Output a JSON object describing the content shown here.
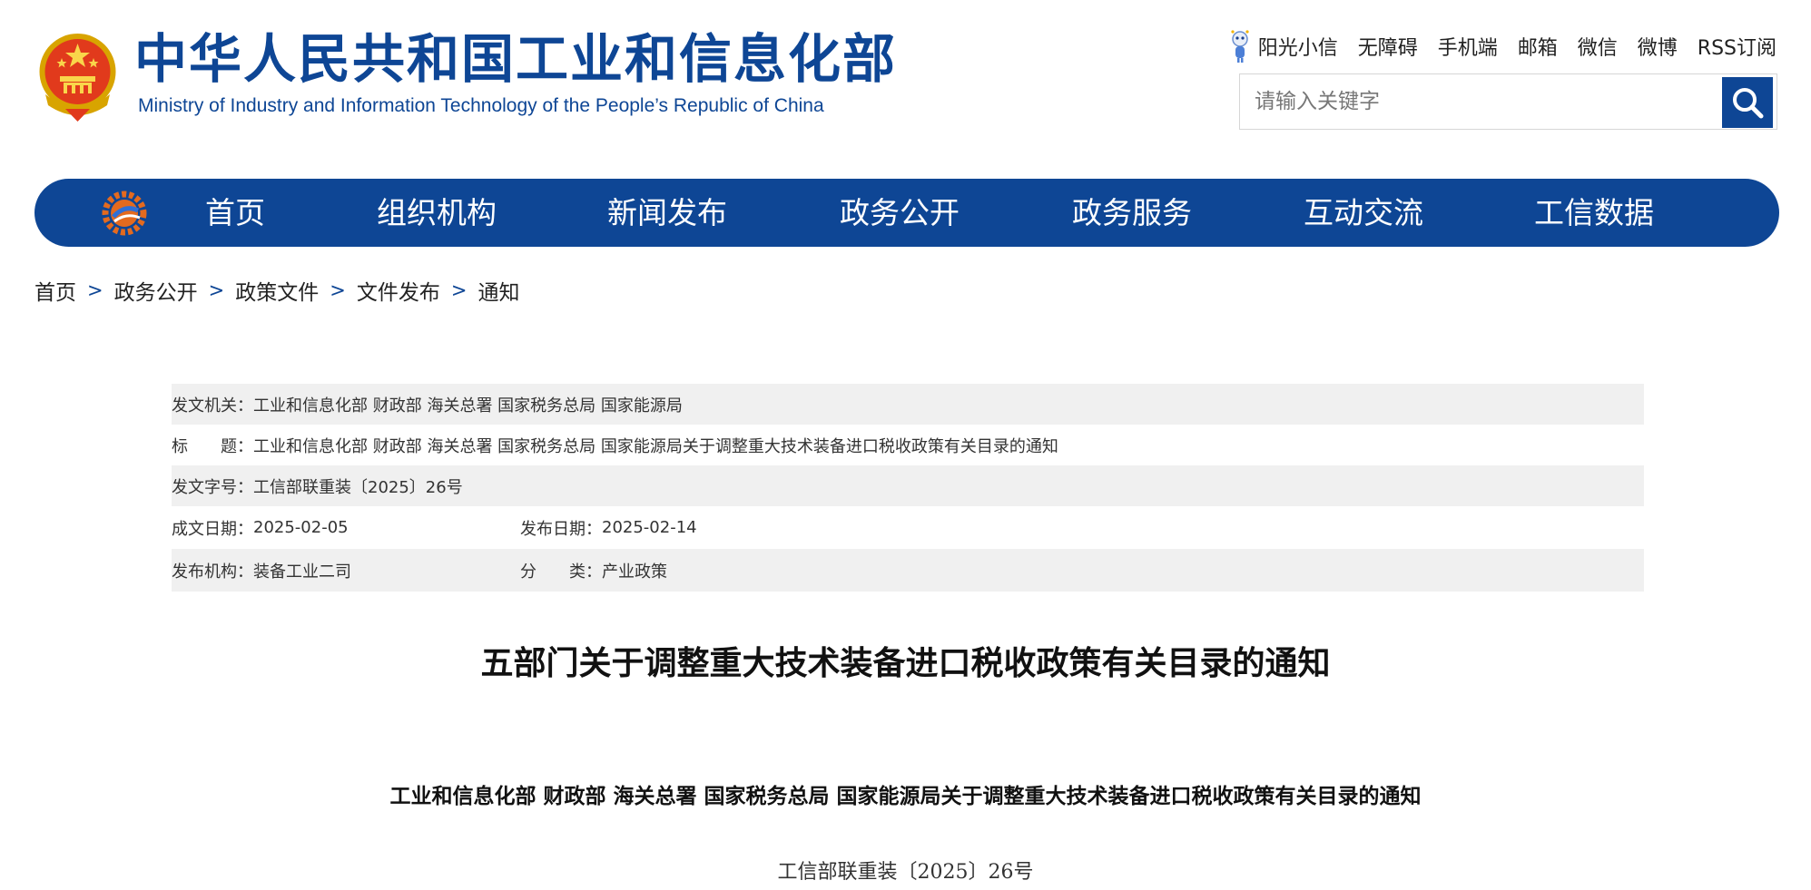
{
  "header": {
    "title": "中华人民共和国工业和信息化部",
    "subtitle": "Ministry of Industry and Information Technology of the People’s Republic of China"
  },
  "top_links": [
    "阳光小信",
    "无障碍",
    "手机端",
    "邮箱",
    "微信",
    "微博",
    "RSS订阅"
  ],
  "search": {
    "placeholder": "请输入关键字"
  },
  "nav": [
    "首页",
    "组织机构",
    "新闻发布",
    "政务公开",
    "政务服务",
    "互动交流",
    "工信数据"
  ],
  "breadcrumb": [
    "首页",
    "政务公开",
    "政策文件",
    "文件发布",
    "通知"
  ],
  "breadcrumb_sep": ">",
  "meta": {
    "issuer_label": "发文机关：",
    "issuer_value": "工业和信息化部 财政部 海关总署 国家税务总局 国家能源局",
    "title_label": "标　　题：",
    "title_value": "工业和信息化部 财政部 海关总署 国家税务总局 国家能源局关于调整重大技术装备进口税收政策有关目录的通知",
    "docno_label": "发文字号：",
    "docno_value": "工信部联重装〔2025〕26号",
    "date_written_label": "成文日期：",
    "date_written_value": "2025-02-05",
    "date_published_label": "发布日期：",
    "date_published_value": "2025-02-14",
    "publisher_label": "发布机构：",
    "publisher_value": "装备工业二司",
    "category_label": "分　　类：",
    "category_value": "产业政策"
  },
  "article": {
    "title": "五部门关于调整重大技术装备进口税收政策有关目录的通知",
    "heading": "工业和信息化部  财政部  海关总署  国家税务总局  国家能源局关于调整重大技术装备进口税收政策有关目录的通知",
    "doc_number": "工信部联重装〔2025〕26号"
  },
  "colors": {
    "brand_blue": "#0e4695",
    "meta_shade": "#f0f0f0"
  }
}
